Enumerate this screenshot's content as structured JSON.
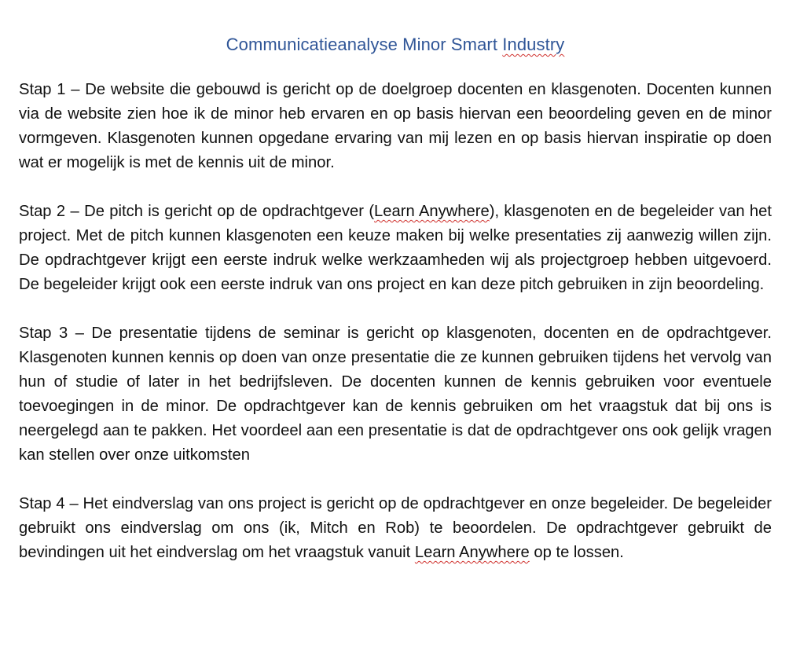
{
  "document": {
    "title": "Communicatieanalyse Minor Smart",
    "title_flagged_word": "Industry",
    "step1": {
      "text": "Stap 1 – De website die gebouwd is gericht op de doelgroep docenten en klasgenoten. Docenten kunnen via de website zien hoe ik de minor heb ervaren en op basis hiervan een beoordeling geven en de minor vormgeven. Klasgenoten kunnen opgedane ervaring van mij lezen en op basis hiervan inspiratie op doen wat er mogelijk is met de kennis uit de minor."
    },
    "step2": {
      "before": "Stap 2 – De pitch is gericht op de opdrachtgever (",
      "flagged": "Learn Anywhere",
      "after": "), klasgenoten en de begeleider van het project. Met de pitch kunnen klasgenoten een keuze maken bij welke presentaties zij aanwezig willen zijn.  De opdrachtgever krijgt een eerste indruk welke werkzaamheden wij als projectgroep hebben uitgevoerd. De begeleider krijgt ook een eerste indruk van ons project en kan deze pitch gebruiken in zijn beoordeling."
    },
    "step3": {
      "text": "Stap 3 – De presentatie tijdens de seminar is gericht op klasgenoten, docenten en de opdrachtgever. Klasgenoten kunnen kennis op doen van onze presentatie die ze kunnen gebruiken tijdens het vervolg van hun of studie of later in het bedrijfsleven. De docenten kunnen de kennis gebruiken voor eventuele toevoegingen in de minor. De opdrachtgever kan de kennis gebruiken om het vraagstuk dat bij ons is neergelegd aan te pakken. Het voordeel aan een presentatie is dat de opdrachtgever ons ook gelijk vragen kan stellen over onze uitkomsten"
    },
    "step4": {
      "before": "Stap 4 – Het eindverslag van ons project is gericht op de opdrachtgever en onze begeleider. De begeleider gebruikt ons eindverslag om ons (ik, Mitch en Rob) te beoordelen. De opdrachtgever gebruikt de bevindingen uit het eindverslag om het vraagstuk vanuit",
      "flagged": "Learn Anywhere",
      "after": "op te lossen."
    },
    "spellcheck_underline_color": "#d0312d",
    "title_color": "#2f5597"
  }
}
